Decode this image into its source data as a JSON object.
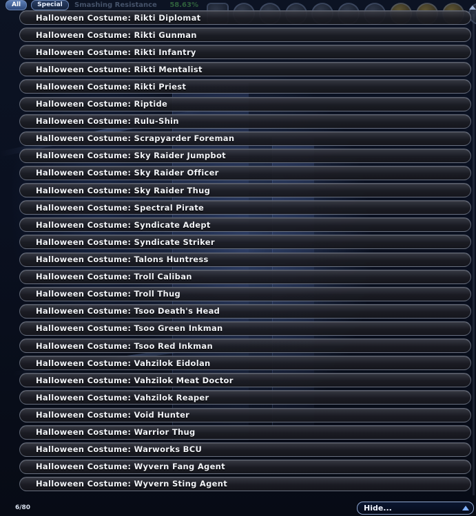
{
  "tabs": [
    {
      "label": "All"
    },
    {
      "label": "Special"
    }
  ],
  "hud": {
    "stats": [
      {
        "label": "Smashing Resistance",
        "value": "58.63%"
      }
    ]
  },
  "list": {
    "items": [
      "Halloween Costume: Rikti Diplomat",
      "Halloween Costume: Rikti Gunman",
      "Halloween Costume: Rikti Infantry",
      "Halloween Costume: Rikti Mentalist",
      "Halloween Costume: Rikti Priest",
      "Halloween Costume: Riptide",
      "Halloween Costume: Rulu-Shin",
      "Halloween Costume: Scrapyarder Foreman",
      "Halloween Costume: Sky Raider Jumpbot",
      "Halloween Costume: Sky Raider Officer",
      "Halloween Costume: Sky Raider Thug",
      "Halloween Costume: Spectral Pirate",
      "Halloween Costume: Syndicate Adept",
      "Halloween Costume: Syndicate Striker",
      "Halloween Costume: Talons Huntress",
      "Halloween Costume: Troll Caliban",
      "Halloween Costume: Troll Thug",
      "Halloween Costume: Tsoo Death's Head",
      "Halloween Costume: Tsoo Green Inkman",
      "Halloween Costume: Tsoo Red Inkman",
      "Halloween Costume: Vahzilok Eidolan",
      "Halloween Costume: Vahzilok Meat Doctor",
      "Halloween Costume: Vahzilok Reaper",
      "Halloween Costume: Void Hunter",
      "Halloween Costume: Warrior Thug",
      "Halloween Costume: Warworks BCU",
      "Halloween Costume: Wyvern Fang Agent",
      "Halloween Costume: Wyvern Sting Agent"
    ]
  },
  "footer": {
    "counter": "6/80",
    "filter": {
      "selected": "Hide...",
      "icon": "chevron-up-icon"
    }
  },
  "colors": {
    "item_text": "#f2f4f8",
    "item_border": "#969fb4",
    "accent": "#7fb0ff"
  }
}
